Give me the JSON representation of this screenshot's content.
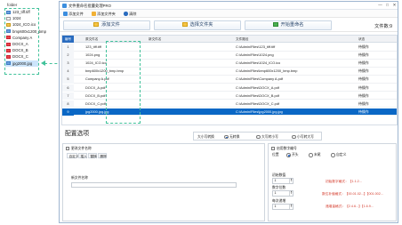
{
  "folder_panel": {
    "title": "folder",
    "files": [
      {
        "name": "123_tiff.tiff",
        "icon": "tiff-file-icon"
      },
      {
        "name": "1024",
        "icon": "file-icon"
      },
      {
        "name": "1024_ICO.ico",
        "icon": "ico-file-icon"
      },
      {
        "name": "bmp600x1200_bmp",
        "icon": "image-file-icon"
      },
      {
        "name": "Company A",
        "icon": "pdf-file-icon"
      },
      {
        "name": "DOCX_A",
        "icon": "pdf-file-icon"
      },
      {
        "name": "DOCX_B",
        "icon": "pdf-file-icon"
      },
      {
        "name": "DOCX_C",
        "icon": "pdf-file-icon"
      },
      {
        "name": "jpg2000.jpg",
        "icon": "image-file-icon"
      }
    ],
    "selected_index": 8
  },
  "window": {
    "title": "文件重命名批量处理PRO",
    "controls": {
      "minimize": "—",
      "maximize": "□",
      "close": "✕"
    }
  },
  "menu": {
    "items": [
      {
        "label": "添加文件",
        "color": "#3c8ede"
      },
      {
        "label": "添加文件夹",
        "color": "#f2b134"
      },
      {
        "label": "清除",
        "color": "#2a6cbf"
      }
    ]
  },
  "toolbar": {
    "add_files": "添加文件",
    "add_folder": "选择文件夹",
    "start": "开始重命名",
    "file_count_label": "文件数:9"
  },
  "table": {
    "columns": [
      "编号",
      "原文件名",
      "新文件名",
      "文件路径",
      "状态"
    ],
    "rows": [
      {
        "no": "1",
        "name": "123_tiff.tiff",
        "new": "",
        "path": "C:\\Admin\\Files\\123_tiff.tiff",
        "status": "待操作"
      },
      {
        "no": "2",
        "name": "1024.png",
        "new": "",
        "path": "C:\\Admin\\Files\\1024.png",
        "status": "待操作"
      },
      {
        "no": "3",
        "name": "1024_ICO.ico",
        "new": "",
        "path": "C:\\Admin\\Files\\1024_ICO.ico",
        "status": "待操作"
      },
      {
        "no": "4",
        "name": "bmp600x1200_bmp.bmp",
        "new": "",
        "path": "C:\\Admin\\Files\\bmp600x1200_bmp.bmp",
        "status": "待操作"
      },
      {
        "no": "5",
        "name": "Company A.pdf",
        "new": "",
        "path": "C:\\Admin\\Files\\Company A.pdf",
        "status": "待操作"
      },
      {
        "no": "6",
        "name": "DOCX_A.pdf",
        "new": "",
        "path": "C:\\Admin\\Files\\DOCX_A.pdf",
        "status": "待操作"
      },
      {
        "no": "7",
        "name": "DOCX_B.pdf",
        "new": "",
        "path": "C:\\Admin\\Files\\DOCX_B.pdf",
        "status": "待操作"
      },
      {
        "no": "8",
        "name": "DOCX_C.pdf",
        "new": "",
        "path": "C:\\Admin\\Files\\DOCX_C.pdf",
        "status": "待操作"
      },
      {
        "no": "9",
        "name": "jpg2000.jpg.jpg",
        "new": "",
        "path": "C:\\Admin\\Files\\jpg2000.jpg.jpg",
        "status": "待操作"
      }
    ],
    "selected_row": 8
  },
  "config": {
    "title": "配置选项",
    "case": {
      "label": "大小写转换",
      "options": [
        "无转换",
        "大写转小写",
        "小写转大写"
      ],
      "selected": 0
    },
    "left": {
      "modify_name_label": "更改文件名称",
      "tabs": [
        "自定义",
        "插入",
        "替换",
        "删除"
      ],
      "new_name_label": "新文件名称",
      "new_name_value": ""
    },
    "right": {
      "enable_number_label": "启用数字编号",
      "position_label": "位置",
      "position_options": [
        "开头",
        "末尾",
        "自定义"
      ],
      "position_selected": 0,
      "start_number_label": "初始数值",
      "start_number_value": "1",
      "digits_label": "数字位数",
      "digits_value": "1",
      "step_label": "每次递增",
      "step_value": "1",
      "preview_lines": [
        "初始数字格式：【1.1.2...",
        "数位补值格式：【00.01.02...】【001.002...",
        "递增量格式：【2.4.6...】【1.6.9..."
      ]
    }
  }
}
